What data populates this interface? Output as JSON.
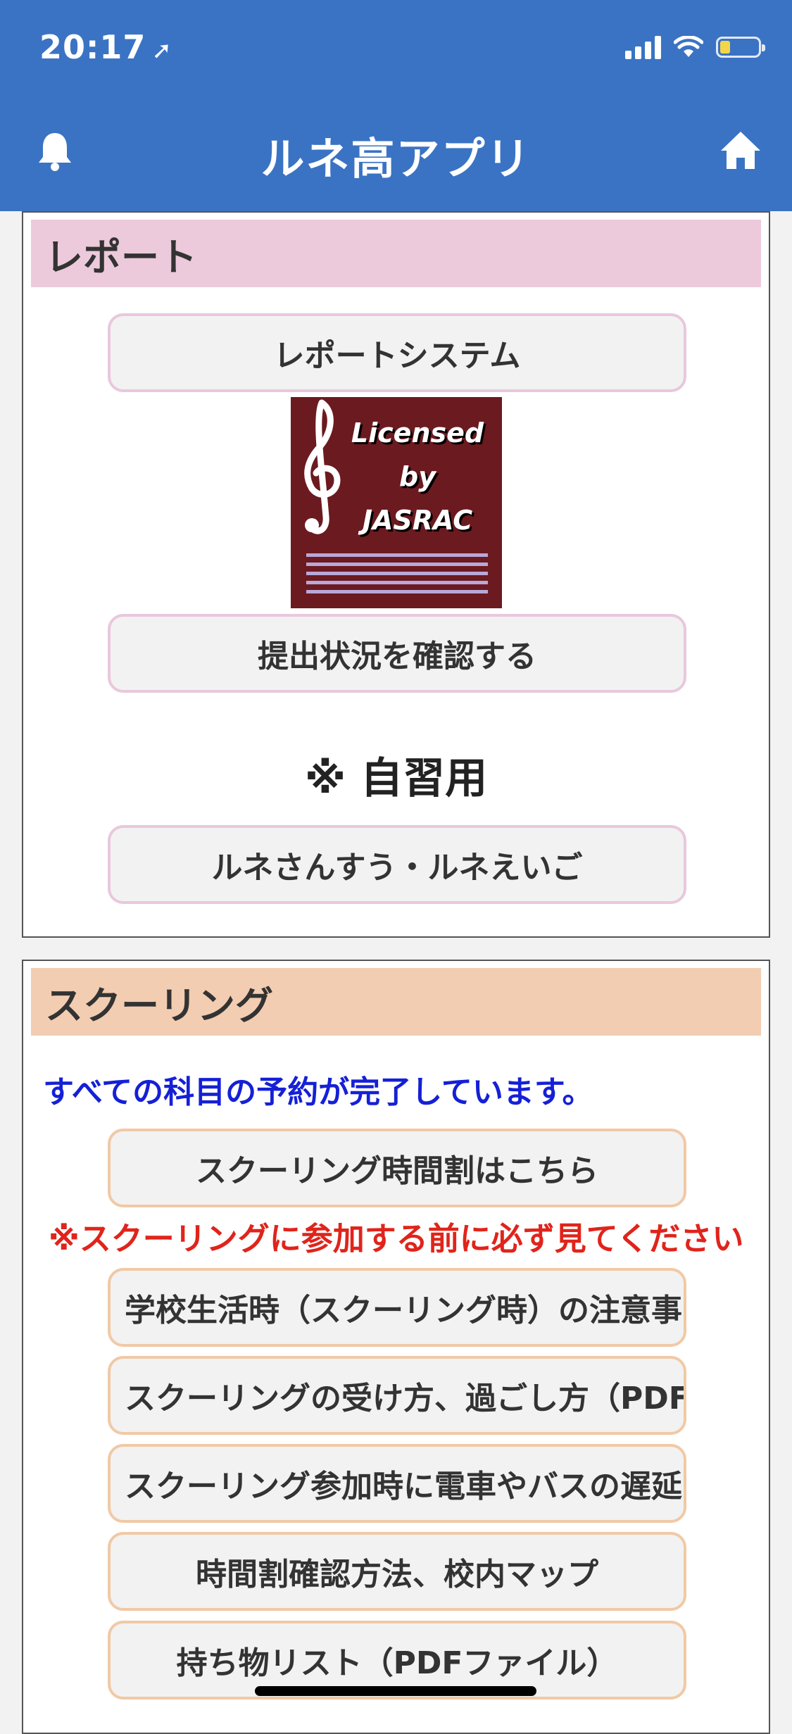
{
  "status_bar": {
    "time": "20:17"
  },
  "nav": {
    "title": "ルネ高アプリ"
  },
  "report": {
    "heading": "レポート",
    "system_button": "レポートシステム",
    "logo_text": [
      "Licensed",
      "by",
      "JASRAC"
    ],
    "status_button": "提出状況を確認する",
    "self_study_label": "※ 自習用",
    "self_study_button": "ルネさんすう・ルネえいご"
  },
  "schooling": {
    "heading": "スクーリング",
    "reservation_notice": "すべての科目の予約が完了しています。",
    "timetable_button": "スクーリング時間割はこちら",
    "warning": "※スクーリングに参加する前に必ず見てください",
    "items": [
      "学校生活時（スクーリング時）の注意事",
      "スクーリングの受け方、過ごし方（PDF",
      "スクーリング参加時に電車やバスの遅延",
      "時間割確認方法、校内マップ",
      "持ち物リスト（PDFファイル）"
    ]
  },
  "colors": {
    "header_bg": "#3a73c4",
    "report_heading_bg": "#eccadb",
    "schooling_heading_bg": "#f2cdb1",
    "notice_blue": "#1520d6",
    "warning_red": "#e0241b"
  }
}
